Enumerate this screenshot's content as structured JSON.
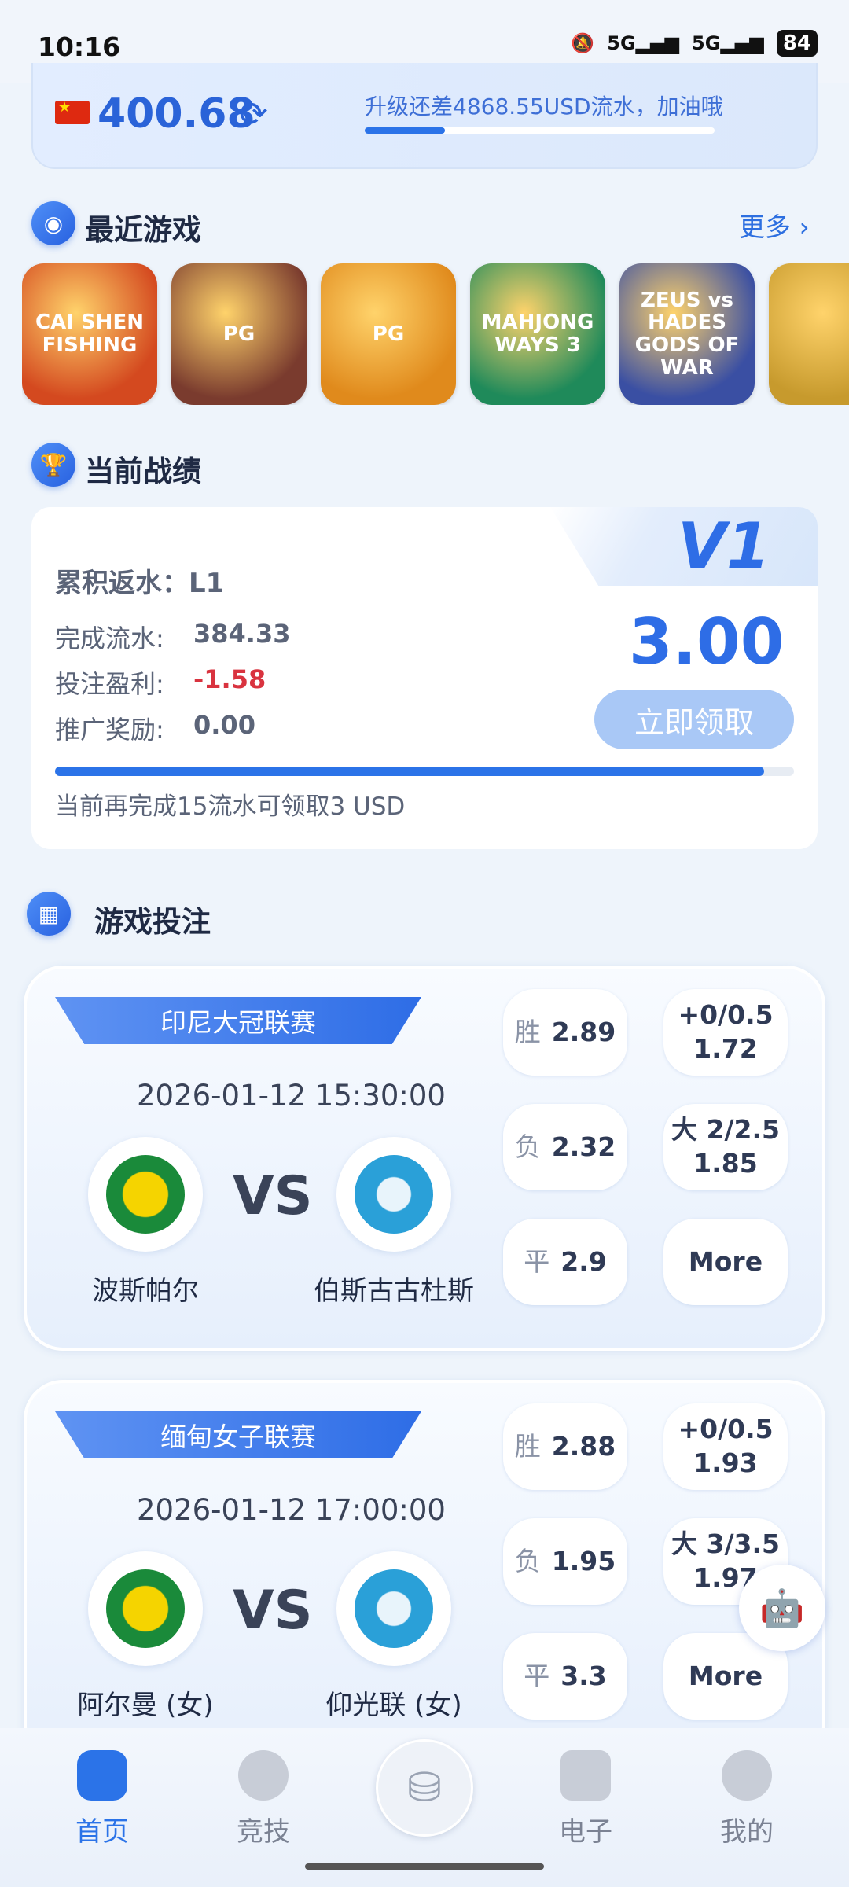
{
  "status_bar": {
    "time": "10:16",
    "signal1": "5G",
    "signal2": "5G",
    "battery": "84"
  },
  "balance": {
    "amount": "400.68",
    "upgrade_text": "升级还差4868.55USD流水，加油哦",
    "upgrade_progress": 0.23
  },
  "recent_games": {
    "title": "最近游戏",
    "more": "更多",
    "tiles": [
      {
        "label": "CAI SHEN FISHING",
        "color": "#d4491f"
      },
      {
        "label": "PG",
        "color": "#7a3b2e"
      },
      {
        "label": "PG",
        "color": "#e08a1c"
      },
      {
        "label": "MAHJONG WAYS 3",
        "color": "#1f8a5a"
      },
      {
        "label": "ZEUS vs HADES GODS OF WAR",
        "color": "#3a4fa3"
      },
      {
        "label": "",
        "color": "#c79a2d"
      }
    ]
  },
  "current_record": {
    "title": "当前战绩",
    "level": "V1",
    "cumulative_label": "累积返水：",
    "cumulative_value": "L1",
    "rows": [
      {
        "label": "完成流水:",
        "value": "384.33"
      },
      {
        "label": "投注盈利:",
        "value": "-1.58"
      },
      {
        "label": "推广奖励:",
        "value": "0.00"
      }
    ],
    "reward": "3.00",
    "claim": "立即领取",
    "progress": 0.96,
    "progress_text": "当前再完成15流水可领取3 USD"
  },
  "betting": {
    "title": "游戏投注",
    "matches": [
      {
        "league": "印尼大冠联赛",
        "time": "2026-01-12 15:30:00",
        "home": "波斯帕尔",
        "away": "伯斯古古杜斯",
        "odds": [
          {
            "k": "胜",
            "v": "2.89"
          },
          {
            "k": "负",
            "v": "2.32"
          },
          {
            "k": "平",
            "v": "2.9"
          }
        ],
        "handicap": [
          {
            "line1": "+0/0.5",
            "line2": "1.72"
          },
          {
            "line1": "大 2/2.5",
            "line2": "1.85"
          }
        ],
        "more": "More"
      },
      {
        "league": "缅甸女子联赛",
        "time": "2026-01-12 17:00:00",
        "home": "阿尔曼 (女)",
        "away": "仰光联 (女)",
        "odds": [
          {
            "k": "胜",
            "v": "2.88"
          },
          {
            "k": "负",
            "v": "1.95"
          },
          {
            "k": "平",
            "v": "3.3"
          }
        ],
        "handicap": [
          {
            "line1": "+0/0.5",
            "line2": "1.93"
          },
          {
            "line1": "大 3/3.5",
            "line2": "1.97"
          }
        ],
        "more": "More"
      }
    ]
  },
  "nav": {
    "items": [
      {
        "label": "首页",
        "active": true
      },
      {
        "label": "竞技",
        "active": false
      },
      {
        "label": "电子",
        "active": false
      },
      {
        "label": "我的",
        "active": false
      }
    ]
  },
  "colors": {
    "accent": "#2b73e8",
    "loss": "#d9333f",
    "bg": "#eef4fb"
  }
}
